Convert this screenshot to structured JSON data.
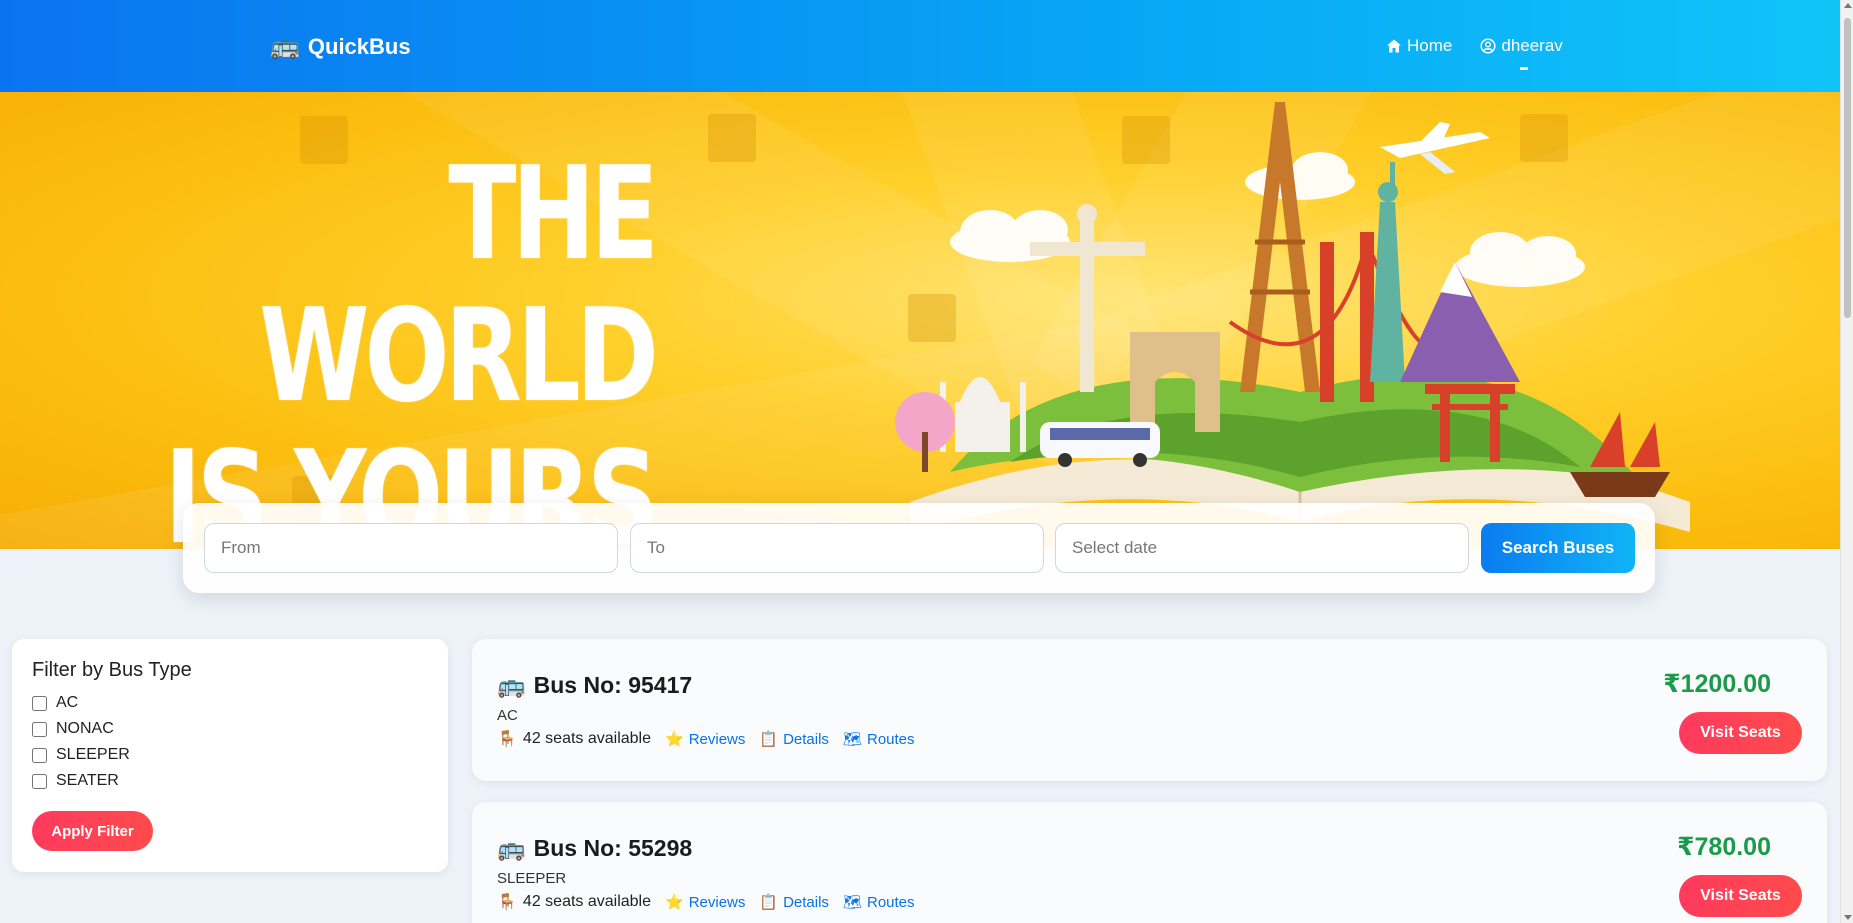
{
  "navbar": {
    "brand_icon": "🚌",
    "brand": "QuickBus",
    "home_label": "Home",
    "user_label": "dheerav"
  },
  "hero": {
    "line1": "THE WORLD",
    "line2": "IS YOURS"
  },
  "search": {
    "from_placeholder": "From",
    "to_placeholder": "To",
    "date_placeholder": "Select date",
    "button_label": "Search Buses"
  },
  "filter": {
    "title": "Filter by Bus Type",
    "options": [
      {
        "label": "AC",
        "checked": false
      },
      {
        "label": "NONAC",
        "checked": false
      },
      {
        "label": "SLEEPER",
        "checked": false
      },
      {
        "label": "SEATER",
        "checked": false
      }
    ],
    "apply_label": "Apply Filter"
  },
  "buses": [
    {
      "icon": "🚌",
      "title": "Bus No: 95417",
      "type": "AC",
      "seats_icon": "🪑",
      "seats": "42 seats available",
      "reviews_icon": "⭐",
      "reviews": "Reviews",
      "details_icon": "📋",
      "details": "Details",
      "routes_icon": "🗺",
      "routes": "Routes",
      "price": "₹1200.00",
      "visit_label": "Visit Seats"
    },
    {
      "icon": "🚌",
      "title": "Bus No: 55298",
      "type": "SLEEPER",
      "seats_icon": "🪑",
      "seats": "42 seats available",
      "reviews_icon": "⭐",
      "reviews": "Reviews",
      "details_icon": "📋",
      "details": "Details",
      "routes_icon": "🗺",
      "routes": "Routes",
      "price": "₹780.00",
      "visit_label": "Visit Seats"
    }
  ],
  "colors": {
    "nav_start": "#0a74f0",
    "nav_end": "#10c4f8",
    "accent_red": "#ff3a5e",
    "price_green": "#1a9a4a",
    "link_blue": "#0a72e8",
    "hero_yellow": "#fbbd0e"
  }
}
